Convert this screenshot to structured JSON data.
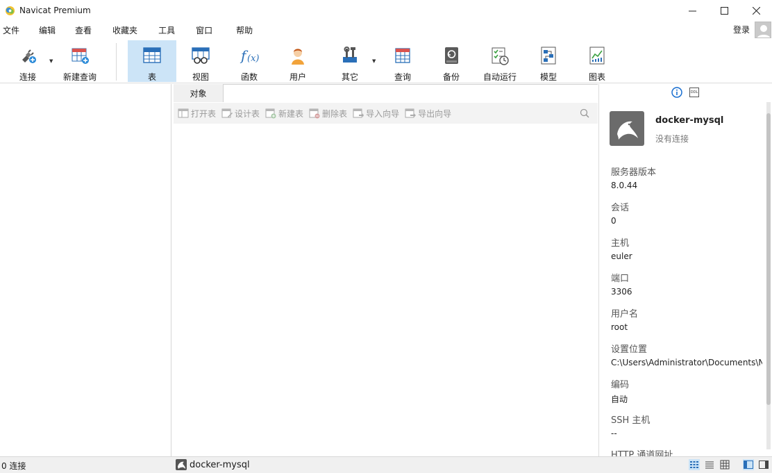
{
  "window": {
    "title": "Navicat Premium"
  },
  "menu": {
    "items": [
      "文件",
      "编辑",
      "查看",
      "收藏夹",
      "工具",
      "窗口",
      "帮助"
    ],
    "login": "登录"
  },
  "toolbar": {
    "connect": "连接",
    "new_query": "新建查询",
    "table": "表",
    "view": "视图",
    "function": "函数",
    "user": "用户",
    "other": "其它",
    "query": "查询",
    "backup": "备份",
    "auto_run": "自动运行",
    "model": "模型",
    "chart": "图表"
  },
  "center": {
    "tab": "对象",
    "actions": {
      "open_table": "打开表",
      "design_table": "设计表",
      "new_table": "新建表",
      "delete_table": "删除表",
      "import_wizard": "导入向导",
      "export_wizard": "导出向导"
    }
  },
  "info": {
    "name": "docker-mysql",
    "status": "没有连接",
    "props": [
      {
        "k": "服务器版本",
        "v": "8.0.44"
      },
      {
        "k": "会话",
        "v": "0"
      },
      {
        "k": "主机",
        "v": "euler"
      },
      {
        "k": "端口",
        "v": "3306"
      },
      {
        "k": "用户名",
        "v": "root"
      },
      {
        "k": "设置位置",
        "v": "C:\\Users\\Administrator\\Documents\\N"
      },
      {
        "k": "编码",
        "v": "自动"
      },
      {
        "k": "SSH 主机",
        "v": "--"
      },
      {
        "k": "HTTP 通道网址",
        "v": ""
      }
    ]
  },
  "status": {
    "connections": "0 连接",
    "current": "docker-mysql"
  },
  "colors": {
    "accent": "#cce4f7",
    "disabled_text": "#9a9a9a"
  }
}
